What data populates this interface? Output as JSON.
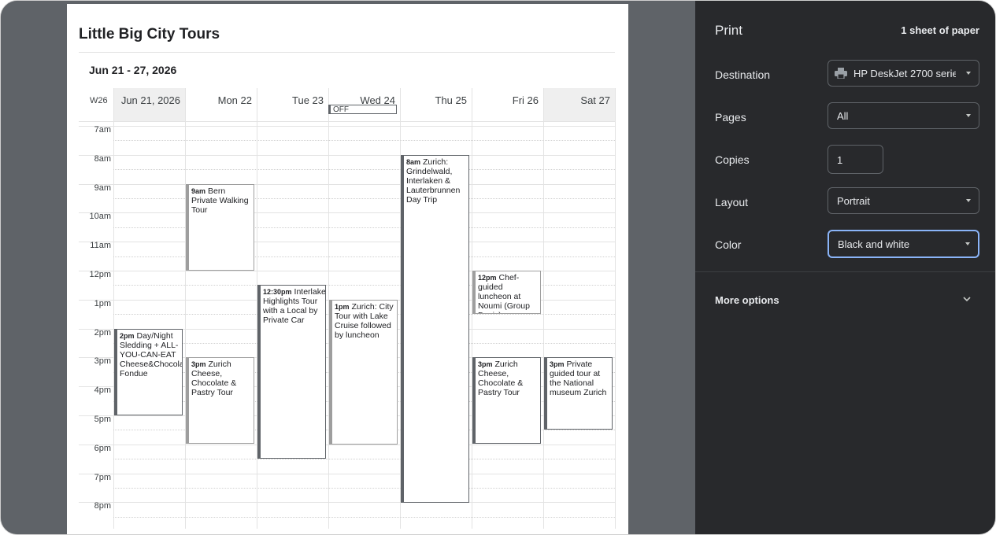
{
  "document": {
    "title": "Little Big City Tours",
    "date_range": "Jun 21 - 27, 2026",
    "week_label": "W26",
    "days": [
      {
        "label": "Jun 21, 2026",
        "shaded": true
      },
      {
        "label": "Mon 22",
        "shaded": false
      },
      {
        "label": "Tue 23",
        "shaded": false
      },
      {
        "label": "Wed 24",
        "shaded": false
      },
      {
        "label": "Thu 25",
        "shaded": false
      },
      {
        "label": "Fri 26",
        "shaded": false
      },
      {
        "label": "Sat 27",
        "shaded": true
      }
    ],
    "all_day_badge": "OFF",
    "hours": [
      "7am",
      "8am",
      "9am",
      "10am",
      "11am",
      "12pm",
      "1pm",
      "2pm",
      "3pm",
      "4pm",
      "5pm",
      "6pm",
      "7pm",
      "8pm"
    ],
    "events": [
      {
        "day": 1,
        "start": 9,
        "end": 12,
        "time": "9am",
        "title": "Bern Private Walking Tour",
        "light": true
      },
      {
        "day": 2,
        "start": 12.5,
        "end": 18.5,
        "time": "12:30pm",
        "title": "Interlaken: Highlights Tour with a Local by Private Car",
        "light": false
      },
      {
        "day": 4,
        "start": 8,
        "end": 20,
        "time": "8am",
        "title": "Zurich: Grindelwald, Interlaken & Lauterbrunnen Day Trip",
        "light": false
      },
      {
        "day": 5,
        "start": 12,
        "end": 13.5,
        "time": "12pm",
        "title": "Chef-guided luncheon at Noumi (Group Davis)",
        "light": true
      },
      {
        "day": 3,
        "start": 13,
        "end": 18,
        "time": "1pm",
        "title": "Zurich: City Tour with Lake Cruise followed by luncheon",
        "light": true
      },
      {
        "day": 0,
        "start": 14,
        "end": 17,
        "time": "2pm",
        "title": "Day/Night Sledding + ALL-YOU-CAN-EAT Cheese&Chocolate Fondue",
        "light": false
      },
      {
        "day": 1,
        "start": 15,
        "end": 18,
        "time": "3pm",
        "title": "Zurich Cheese, Chocolate & Pastry Tour",
        "light": true
      },
      {
        "day": 5,
        "start": 15,
        "end": 18,
        "time": "3pm",
        "title": "Zurich Cheese, Chocolate & Pastry Tour",
        "light": false
      },
      {
        "day": 6,
        "start": 15,
        "end": 17.5,
        "time": "3pm",
        "title": "Private guided tour at the National museum Zurich",
        "light": false
      }
    ]
  },
  "print": {
    "title": "Print",
    "sheets": "1 sheet of paper",
    "destination_label": "Destination",
    "destination_value": "HP DeskJet 2700 series",
    "destination_icon": "printer-icon",
    "pages_label": "Pages",
    "pages_value": "All",
    "copies_label": "Copies",
    "copies_value": "1",
    "layout_label": "Layout",
    "layout_value": "Portrait",
    "color_label": "Color",
    "color_value": "Black and white",
    "more_options": "More options"
  }
}
